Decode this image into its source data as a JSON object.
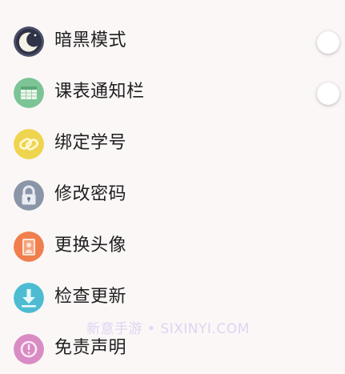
{
  "settings": {
    "items": [
      {
        "label": "暗黑模式",
        "icon": "moon-icon",
        "color": "#4a4e66",
        "toggle": false
      },
      {
        "label": "课表通知栏",
        "icon": "schedule-table-icon",
        "color": "#7cc496",
        "toggle": false
      },
      {
        "label": "绑定学号",
        "icon": "link-chain-icon",
        "color": "#efd54f"
      },
      {
        "label": "修改密码",
        "icon": "lock-icon",
        "color": "#8a96a8"
      },
      {
        "label": "更换头像",
        "icon": "avatar-portrait-icon",
        "color": "#f07f4d"
      },
      {
        "label": "检查更新",
        "icon": "download-icon",
        "color": "#4dbcd3"
      },
      {
        "label": "免责声明",
        "icon": "disclaimer-icon",
        "color": "#d98bc3"
      }
    ]
  },
  "watermark": {
    "text": "新意手游 • SIXINYI.COM"
  }
}
